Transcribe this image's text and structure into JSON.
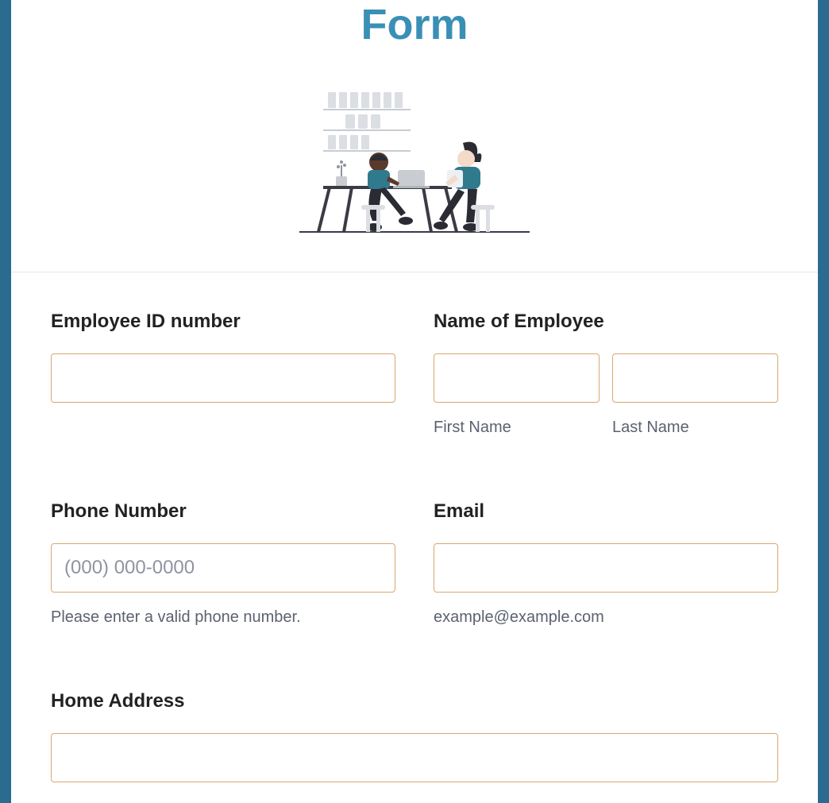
{
  "header": {
    "title": "Form"
  },
  "fields": {
    "employee_id": {
      "label": "Employee ID number"
    },
    "name": {
      "label": "Name of Employee",
      "first_sublabel": "First Name",
      "last_sublabel": "Last Name"
    },
    "phone": {
      "label": "Phone Number",
      "placeholder": "(000) 000-0000",
      "hint": "Please enter a valid phone number."
    },
    "email": {
      "label": "Email",
      "hint": "example@example.com"
    },
    "address": {
      "label": "Home Address"
    }
  }
}
